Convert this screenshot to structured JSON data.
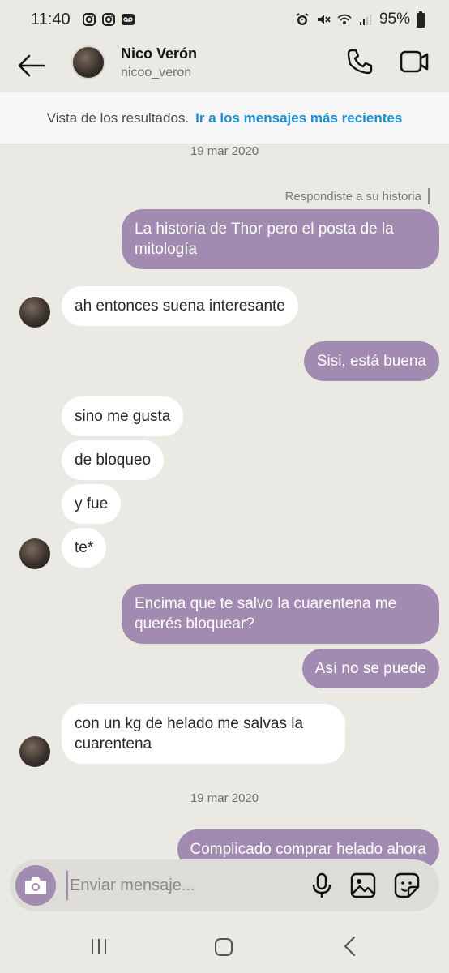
{
  "status_bar": {
    "time": "11:40",
    "battery": "95%"
  },
  "header": {
    "name": "Nico Verón",
    "username": "nicoo_veron"
  },
  "results_bar": {
    "label": "Vista de los resultados.",
    "link": "Ir a los mensajes más recientes"
  },
  "dates": [
    "19 mar 2020",
    "19 mar 2020"
  ],
  "replied_label": "Respondiste a su historia",
  "messages": [
    {
      "dir": "out",
      "text": "La historia de Thor pero el posta de la mitología"
    },
    {
      "dir": "in",
      "text": "ah entonces suena interesante"
    },
    {
      "dir": "out",
      "text": "Sisi, está buena"
    },
    {
      "dir": "in",
      "text": "sino me gusta"
    },
    {
      "dir": "in",
      "text": "de bloqueo"
    },
    {
      "dir": "in",
      "text": "y fue"
    },
    {
      "dir": "in",
      "text": "te*"
    },
    {
      "dir": "out",
      "text": "Encima que te salvo la cuarentena me querés bloquear?"
    },
    {
      "dir": "out",
      "text": "Así no se puede"
    },
    {
      "dir": "in",
      "text": "con un kg de helado me salvas la cuarentena"
    },
    {
      "dir": "out",
      "text": "Complicado comprar helado ahora"
    }
  ],
  "composer": {
    "placeholder": "Enviar mensaje..."
  },
  "icons": {
    "back": "arrow-left-icon",
    "call": "phone-icon",
    "video": "video-camera-icon",
    "camera": "camera-icon",
    "mic": "microphone-icon",
    "gallery": "image-icon",
    "sticker": "sticker-icon"
  },
  "colors": {
    "outgoing_bubble": "#a28bb0",
    "incoming_bubble": "#ffffff",
    "background": "#eae9e4",
    "link": "#1a8fd6"
  }
}
